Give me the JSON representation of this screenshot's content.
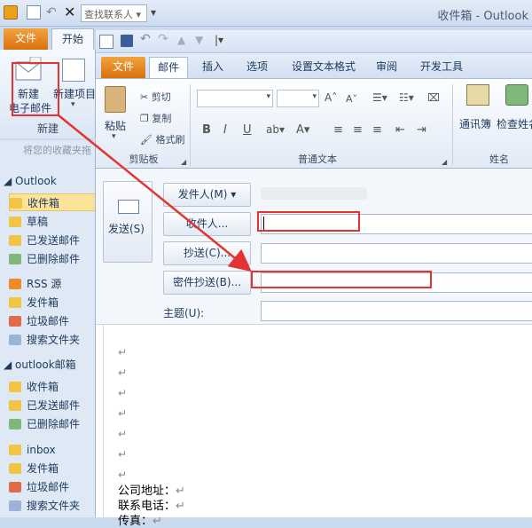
{
  "main_window": {
    "title": "收件箱 - Outlook",
    "search_placeholder": "查找联系人",
    "tabs": [
      "文件",
      "开始"
    ]
  },
  "left_ribbon": {
    "new_email_line1": "新建",
    "new_email_line2": "电子邮件",
    "new_items": "新建项目",
    "group_label": "新建"
  },
  "nav": {
    "favorites_hint": "将您的收藏夹拖",
    "account1": "Outlook",
    "account1_items": [
      "收件箱",
      "草稿",
      "已发送邮件",
      "已删除邮件",
      "RSS 源",
      "发件箱",
      "垃圾邮件",
      "搜索文件夹"
    ],
    "account2": "outlook邮箱",
    "account2_items": [
      "收件箱",
      "已发送邮件",
      "已删除邮件",
      "inbox",
      "发件箱",
      "垃圾邮件",
      "搜索文件夹"
    ]
  },
  "compose": {
    "tabs": [
      "文件",
      "邮件",
      "插入",
      "选项",
      "设置文本格式",
      "审阅",
      "开发工具"
    ],
    "clipboard": {
      "paste": "粘贴",
      "cut": "剪切",
      "copy": "复制",
      "format_painter": "格式刷",
      "label": "剪贴板"
    },
    "basic_text_label": "普通文本",
    "names": {
      "address_book": "通讯簿",
      "check_names": "检查姓名",
      "label": "姓名"
    },
    "send": "发送(S)",
    "from": "发件人(M) ▾",
    "to": "收件人...",
    "cc": "抄送(C)...",
    "bcc": "密件抄送(B)...",
    "subject": "主题(U):",
    "signature": [
      "公司地址：",
      "联系电话：",
      "传真："
    ]
  },
  "colors": {
    "annotation": "#e53232",
    "file_tab": "#e8821e"
  }
}
